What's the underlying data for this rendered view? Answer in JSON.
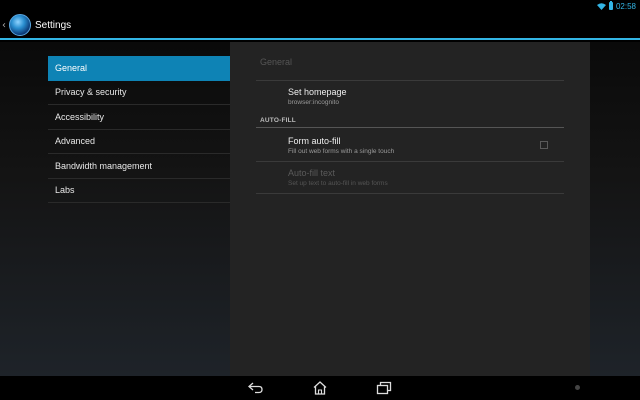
{
  "status_bar": {
    "time": "02:58"
  },
  "action_bar": {
    "title": "Settings"
  },
  "left_menu": {
    "items": [
      {
        "label": "General",
        "selected": true
      },
      {
        "label": "Privacy & security",
        "selected": false
      },
      {
        "label": "Accessibility",
        "selected": false
      },
      {
        "label": "Advanced",
        "selected": false
      },
      {
        "label": "Bandwidth management",
        "selected": false
      },
      {
        "label": "Labs",
        "selected": false
      }
    ]
  },
  "panel": {
    "header": "General",
    "homepage": {
      "title": "Set homepage",
      "summary": "browser:incognito"
    },
    "category": "AUTO-FILL",
    "form_autofill": {
      "title": "Form auto-fill",
      "summary": "Fill out web forms with a single touch",
      "checked": false
    },
    "autofill_text": {
      "title": "Auto-fill text",
      "summary": "Set up text to auto-fill in web forms",
      "enabled": false
    }
  },
  "colors": {
    "accent": "#33b5e5",
    "selected_bg": "#0e83b5"
  },
  "icons": [
    "wifi-icon",
    "battery-icon",
    "browser-globe-icon",
    "back-icon",
    "home-icon",
    "recent-apps-icon"
  ]
}
